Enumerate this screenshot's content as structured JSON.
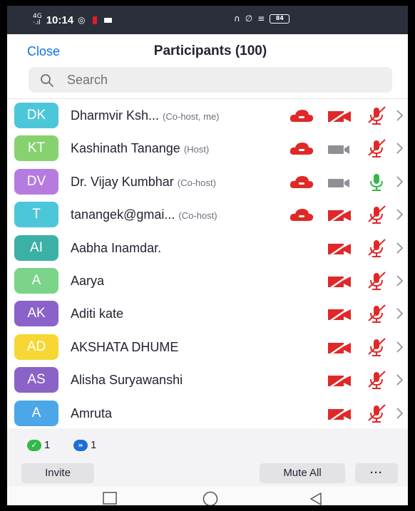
{
  "status_bar": {
    "signal": "4G\n···",
    "time": "10:14",
    "whatsapp_icon": "◎",
    "right_icons": "∩ ∅ ≡",
    "battery": "84"
  },
  "header": {
    "close_label": "Close",
    "title": "Participants (100)"
  },
  "search": {
    "placeholder": "Search",
    "value": ""
  },
  "participants": [
    {
      "initials": "DK",
      "name": "Dharmvir Ksh...",
      "role": "(Co-host, me)",
      "color": "#4cc7da",
      "cloud": true,
      "video": "off",
      "mic": "muted"
    },
    {
      "initials": "KT",
      "name": "Kashinath Tanange",
      "role": "(Host)",
      "color": "#87d26e",
      "cloud": true,
      "video": "on",
      "mic": "muted"
    },
    {
      "initials": "DV",
      "name": "Dr. Vijay Kumbhar",
      "role": "(Co-host)",
      "color": "#b67be0",
      "cloud": true,
      "video": "on",
      "mic": "on"
    },
    {
      "initials": "T",
      "name": "tanangek@gmai...",
      "role": "(Co-host)",
      "color": "#4cc7da",
      "cloud": true,
      "video": "off",
      "mic": "muted"
    },
    {
      "initials": "AI",
      "name": "Aabha Inamdar.",
      "role": "",
      "color": "#3bb1a6",
      "cloud": false,
      "video": "off",
      "mic": "muted"
    },
    {
      "initials": "A",
      "name": "Aarya",
      "role": "",
      "color": "#7ad489",
      "cloud": false,
      "video": "off",
      "mic": "muted"
    },
    {
      "initials": "AK",
      "name": "Aditi kate",
      "role": "",
      "color": "#8a62c9",
      "cloud": false,
      "video": "off",
      "mic": "muted"
    },
    {
      "initials": "AD",
      "name": "AKSHATA DHUME",
      "role": "",
      "color": "#f6d733",
      "cloud": false,
      "video": "off",
      "mic": "muted"
    },
    {
      "initials": "AS",
      "name": "Alisha Suryawanshi",
      "role": "",
      "color": "#8b63c6",
      "cloud": false,
      "video": "off",
      "mic": "muted"
    },
    {
      "initials": "A",
      "name": "Amruta",
      "role": "",
      "color": "#4ba7e8",
      "cloud": false,
      "video": "off",
      "mic": "muted"
    }
  ],
  "footer": {
    "raised_count": "1",
    "faster_count": "1",
    "invite_label": "Invite",
    "mute_all_label": "Mute All",
    "more_label": "···"
  },
  "colors": {
    "accent": "#0e71eb",
    "danger": "#e02828",
    "on_green": "#33b84a",
    "icon_gray": "#8f8f96"
  },
  "nav": {
    "recents_icon": "square-icon",
    "home_icon": "circle-icon",
    "back_icon": "triangle-icon"
  }
}
